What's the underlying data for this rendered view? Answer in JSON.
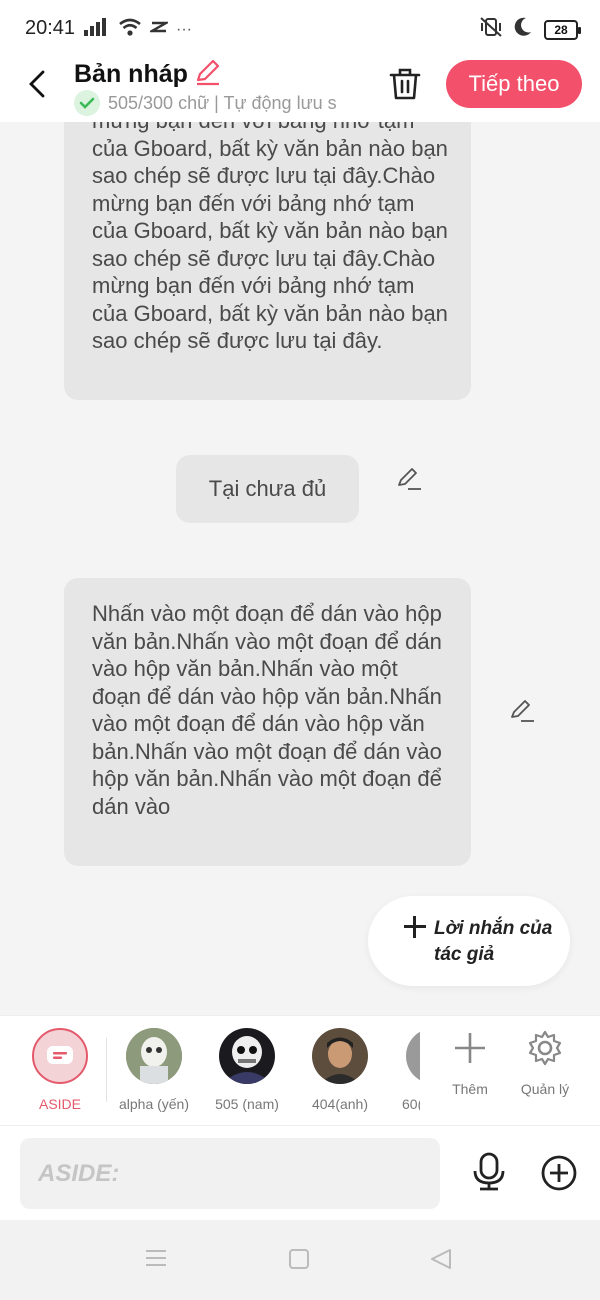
{
  "status_bar": {
    "time": "20:41",
    "battery": "28",
    "icons": [
      "signal-icon",
      "wifi-icon",
      "capcut-icon",
      "more-dots-icon",
      "vibrate-icon",
      "moon-icon",
      "battery-icon"
    ],
    "more_dots": "···"
  },
  "header": {
    "title": "Bản nháp",
    "subtitle": "505/300 chữ | Tự động lưu s",
    "next_label": "Tiếp theo",
    "accent_color": "#f2506b"
  },
  "messages": [
    {
      "text": "mừng bạn đến với bảng nhớ tạm của Gboard, bất kỳ văn bản nào bạn sao chép sẽ được lưu tại đây.Chào mừng bạn đến với bảng nhớ tạm của Gboard, bất kỳ văn bản nào bạn sao chép sẽ được lưu tại đây.Chào mừng bạn đến với bảng nhớ tạm của Gboard, bất kỳ văn bản nào bạn sao chép sẽ được lưu tại đây."
    },
    {
      "text": "Tại chưa đủ"
    },
    {
      "text": "Nhấn vào một đoạn để dán vào hộp văn bản.Nhấn vào một đoạn để dán vào hộp văn bản.Nhấn vào một đoạn để dán vào hộp văn bản.Nhấn vào một đoạn để dán vào hộp văn bản.Nhấn vào một đoạn để dán vào hộp văn bản.Nhấn vào một đoạn để dán vào"
    }
  ],
  "author_note": {
    "label": "Lời nhắn của tác giả"
  },
  "characters": [
    {
      "name": "ASIDE",
      "selected": true
    },
    {
      "name": "alpha (yến)"
    },
    {
      "name": "505 (nam)"
    },
    {
      "name": "404(anh)"
    },
    {
      "name": "60("
    }
  ],
  "tools": {
    "add_label": "Thêm",
    "manage_label": "Quản lý"
  },
  "input": {
    "placeholder": "ASIDE:"
  }
}
